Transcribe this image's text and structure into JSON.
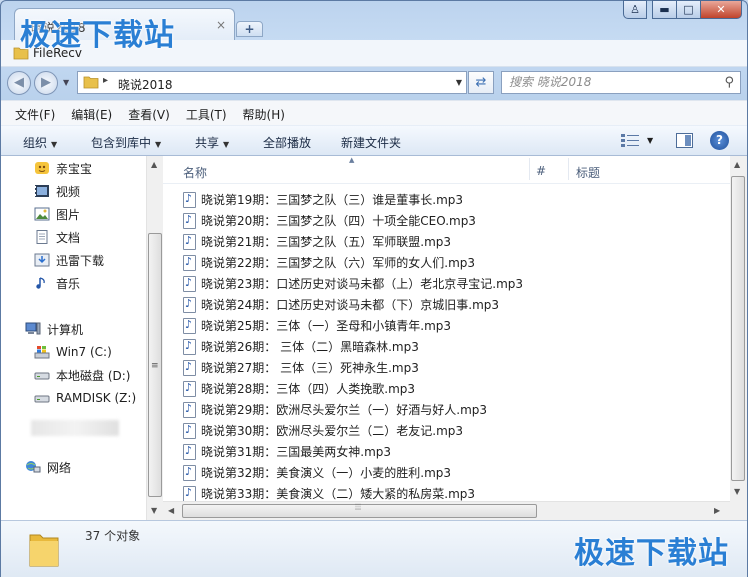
{
  "watermark": "极速下载站",
  "window": {
    "tab_title": "晓说2018",
    "tab_close": "×",
    "tab_new": "+",
    "subtitle": "FileRecv",
    "caption": {
      "user": "♙",
      "minimize": "▬",
      "maximize": "□",
      "close": "✕"
    }
  },
  "address": {
    "crumb": "晓说2018",
    "search_placeholder": "搜索 晓说2018"
  },
  "menu": [
    "文件(F)",
    "编辑(E)",
    "查看(V)",
    "工具(T)",
    "帮助(H)"
  ],
  "toolbar": {
    "organize": "组织",
    "include_in_library": "包含到库中",
    "share": "共享",
    "play_all": "全部播放",
    "new_folder": "新建文件夹"
  },
  "nav": {
    "favorites": [
      {
        "label": "亲宝宝",
        "icon": "baby-icon"
      },
      {
        "label": "视频",
        "icon": "video-library-icon"
      },
      {
        "label": "图片",
        "icon": "picture-library-icon"
      },
      {
        "label": "文档",
        "icon": "document-library-icon"
      },
      {
        "label": "迅雷下载",
        "icon": "download-icon"
      },
      {
        "label": "音乐",
        "icon": "music-library-icon"
      }
    ],
    "computer": "计算机",
    "drives": [
      {
        "label": "Win7 (C:)",
        "icon": "system-drive-icon"
      },
      {
        "label": "本地磁盘 (D:)",
        "icon": "drive-icon"
      },
      {
        "label": "RAMDISK (Z:)",
        "icon": "drive-icon"
      }
    ],
    "network": "网络"
  },
  "columns": {
    "name": "名称",
    "number": "#",
    "title": "标题"
  },
  "files": [
    "晓说第19期：三国梦之队（三）谁是董事长.mp3",
    "晓说第20期：三国梦之队（四）十项全能CEO.mp3",
    "晓说第21期：三国梦之队（五）军师联盟.mp3",
    "晓说第22期：三国梦之队（六）军师的女人们.mp3",
    "晓说第23期：口述历史对谈马未都（上）老北京寻宝记.mp3",
    "晓说第24期：口述历史对谈马未都（下）京城旧事.mp3",
    "晓说第25期：三体（一）圣母和小镇青年.mp3",
    "晓说第26期： 三体（二）黑暗森林.mp3",
    "晓说第27期： 三体（三）死神永生.mp3",
    "晓说第28期：三体（四）人类挽歌.mp3",
    "晓说第29期：欧洲尽头爱尔兰（一）好酒与好人.mp3",
    "晓说第30期：欧洲尽头爱尔兰（二）老友记.mp3",
    "晓说第31期：三国最美两女神.mp3",
    "晓说第32期：美食演义（一）小麦的胜利.mp3",
    "晓说第33期：美食演义（二）矮大紧的私房菜.mp3"
  ],
  "status": {
    "count": "37 个对象"
  },
  "colors": {
    "accent": "#2a7fd4",
    "frame": "#bcd3ee"
  }
}
